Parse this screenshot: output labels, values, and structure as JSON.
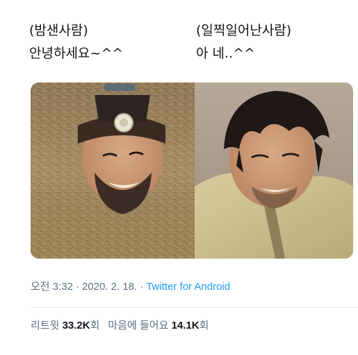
{
  "captions": {
    "left": {
      "role": "(밤샌사람)",
      "speech": "안녕하세요~^^"
    },
    "right": {
      "role": "(일찍일어난사람)",
      "speech": "아 네..^^"
    }
  },
  "tweet": {
    "time": "오전 3:32",
    "separator": "·",
    "date": "2020. 2. 18.",
    "client": "Twitter for Android",
    "retweets_label": "리트윗",
    "retweets_count": "33.2K",
    "retweets_unit": "회",
    "likes_label": "마음에 들어요",
    "likes_count": "14.1K",
    "likes_unit": "회"
  },
  "colors": {
    "meta_text": "#5b7083",
    "link": "#1d9bf0",
    "divider": "#e6ecf0"
  }
}
